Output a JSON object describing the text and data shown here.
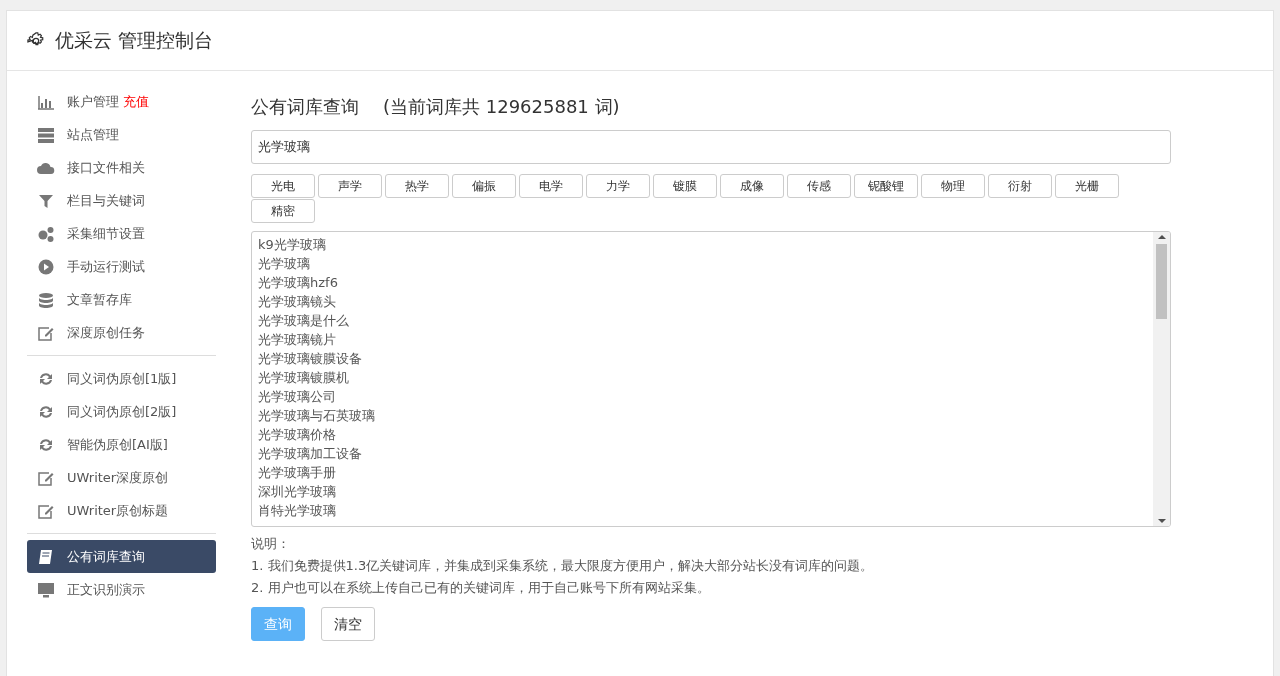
{
  "header": {
    "title": "优采云 管理控制台"
  },
  "sidebar": {
    "groups": [
      [
        {
          "kind": "chart",
          "label": "账户管理",
          "extra": "充值",
          "selected": false
        },
        {
          "kind": "server",
          "label": "站点管理",
          "selected": false
        },
        {
          "kind": "cloud",
          "label": "接口文件相关",
          "selected": false
        },
        {
          "kind": "filter",
          "label": "栏目与关键词",
          "selected": false
        },
        {
          "kind": "gears",
          "label": "采集细节设置",
          "selected": false
        },
        {
          "kind": "play",
          "label": "手动运行测试",
          "selected": false
        },
        {
          "kind": "database",
          "label": "文章暂存库",
          "selected": false
        },
        {
          "kind": "edit",
          "label": "深度原创任务",
          "selected": false
        }
      ],
      [
        {
          "kind": "refresh",
          "label": "同义词伪原创[1版]",
          "selected": false
        },
        {
          "kind": "refresh",
          "label": "同义词伪原创[2版]",
          "selected": false
        },
        {
          "kind": "refresh",
          "label": "智能伪原创[AI版]",
          "selected": false
        },
        {
          "kind": "edit",
          "label": "UWriter深度原创",
          "selected": false
        },
        {
          "kind": "edit",
          "label": "UWriter原创标题",
          "selected": false
        }
      ],
      [
        {
          "kind": "book",
          "label": "公有词库查询",
          "selected": true
        },
        {
          "kind": "monitor",
          "label": "正文识别演示",
          "selected": false
        }
      ]
    ]
  },
  "main": {
    "title": "公有词库查询",
    "subtitle": "(当前词库共 129625881 词)",
    "search": {
      "value": "光学玻璃"
    },
    "tags": [
      "光电",
      "声学",
      "热学",
      "偏振",
      "电学",
      "力学",
      "镀膜",
      "成像",
      "传感",
      "铌酸锂",
      "物理",
      "衍射",
      "光栅",
      "精密"
    ],
    "results": [
      "k9光学玻璃",
      "光学玻璃",
      "光学玻璃hzf6",
      "光学玻璃镜头",
      "光学玻璃是什么",
      "光学玻璃镜片",
      "光学玻璃镀膜设备",
      "光学玻璃镀膜机",
      "光学玻璃公司",
      "光学玻璃与石英玻璃",
      "光学玻璃价格",
      "光学玻璃加工设备",
      "光学玻璃手册",
      "深圳光学玻璃",
      "肖特光学玻璃"
    ],
    "notes_title": "说明：",
    "notes": [
      "1. 我们免费提供1.3亿关键词库，并集成到采集系统，最大限度方便用户，解决大部分站长没有词库的问题。",
      "2. 用户也可以在系统上传自己已有的关键词库，用于自己账号下所有网站采集。"
    ],
    "buttons": [
      {
        "label": "查询",
        "kind": "primary"
      },
      {
        "label": "清空",
        "kind": "secondary"
      }
    ]
  }
}
